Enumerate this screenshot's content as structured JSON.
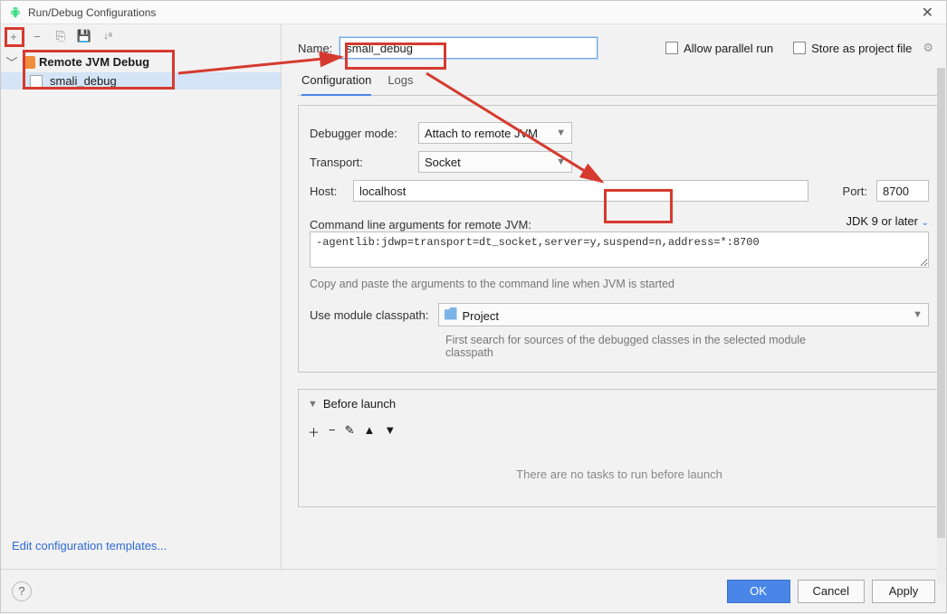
{
  "title": "Run/Debug Configurations",
  "toolbar": {
    "add": "+",
    "remove": "−",
    "copy": "⎘",
    "save": "📄",
    "sort": "↓ª"
  },
  "tree": {
    "type_label": "Remote JVM Debug",
    "config_label": "smali_debug"
  },
  "edit_templates": "Edit configuration templates...",
  "name_label": "Name:",
  "name_value": "smali_debug",
  "allow_parallel": "Allow parallel run",
  "store_project": "Store as project file",
  "tabs": {
    "config": "Configuration",
    "logs": "Logs"
  },
  "debug": {
    "mode_label": "Debugger mode:",
    "mode_value": "Attach to remote JVM",
    "transport_label": "Transport:",
    "transport_value": "Socket",
    "host_label": "Host:",
    "host_value": "localhost",
    "port_label": "Port:",
    "port_value": "8700",
    "cmd_label": "Command line arguments for remote JVM:",
    "jdk_link": "JDK 9 or later",
    "cmd_value": "-agentlib:jdwp=transport=dt_socket,server=y,suspend=n,address=*:8700",
    "cmd_hint": "Copy and paste the arguments to the command line when JVM is started",
    "classpath_label": "Use module classpath:",
    "classpath_value": "Project",
    "classpath_hint": "First search for sources of the debugged classes in the selected module classpath"
  },
  "before": {
    "title": "Before launch",
    "empty": "There are no tasks to run before launch"
  },
  "buttons": {
    "ok": "OK",
    "cancel": "Cancel",
    "apply": "Apply",
    "help": "?"
  }
}
